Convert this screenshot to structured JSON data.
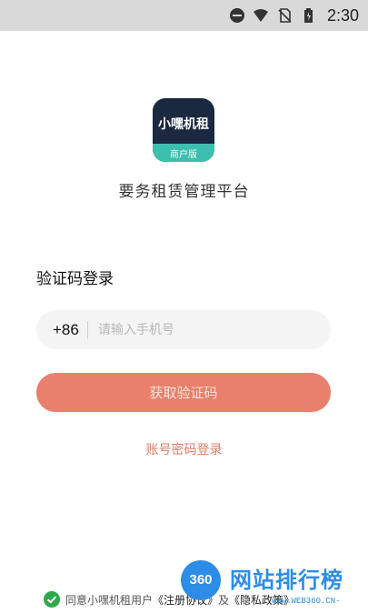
{
  "status_bar": {
    "time": "2:30",
    "icons": [
      "do-not-disturb-icon",
      "wifi-icon",
      "no-sim-icon",
      "battery-icon"
    ]
  },
  "app": {
    "logo_title": "小嘿机租",
    "logo_subtitle": "商户版",
    "slogan": "要务租赁管理平台"
  },
  "login": {
    "title": "验证码登录",
    "country_code": "+86",
    "phone_placeholder": "请输入手机号",
    "phone_value": "",
    "get_code_label": "获取验证码",
    "password_login_label": "账号密码登录"
  },
  "agreement": {
    "prefix": "同意小嘿机租用户",
    "terms": "《注册协议》",
    "and": "及",
    "privacy": "《隐私政策》",
    "checked": true
  },
  "watermark": {
    "badge": "360",
    "text": "网站排行榜",
    "url": "www.WEB360.CN-"
  },
  "colors": {
    "primary": "#e8806c",
    "link": "#e07c69",
    "check": "#2ea84a",
    "logo_bg": "#1a2840",
    "logo_band": "#3dbfae"
  }
}
